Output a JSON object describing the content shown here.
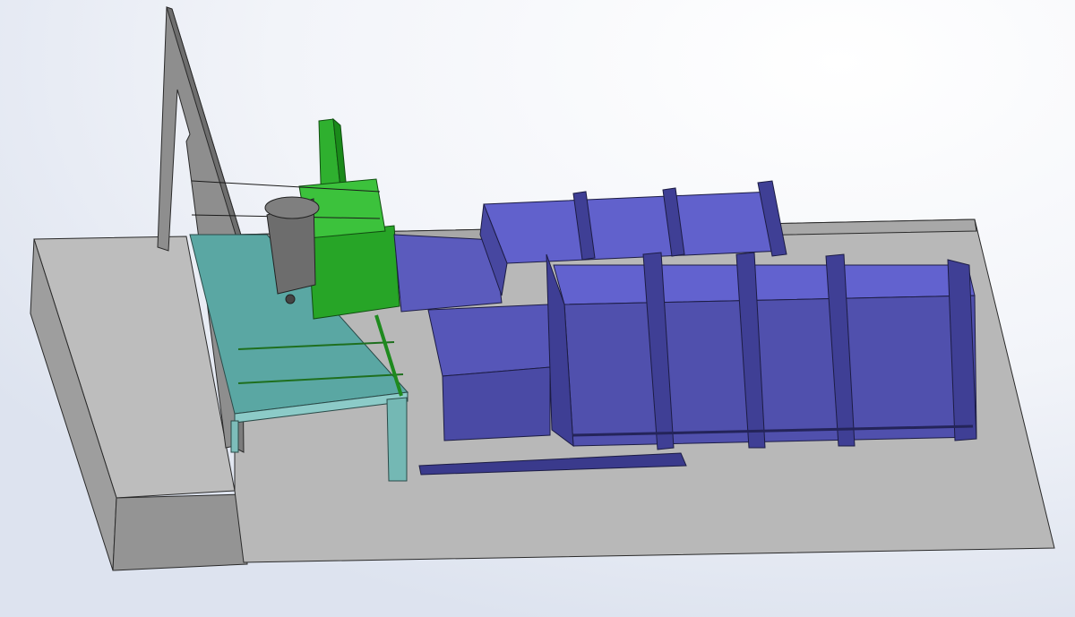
{
  "scene": {
    "colors": {
      "background_light": "#ffffff",
      "background_shade": "#dde3ef",
      "concrete_top": "#bdbdbd",
      "concrete_side": "#a2a2a2",
      "concrete_front": "#939393",
      "wall_face": "#8e8e8e",
      "wall_edge": "#6e6e6e",
      "platform_teal": "#56a3a0",
      "platform_teal_light": "#8ccbc8",
      "machine_green": "#27a527",
      "machine_green_dark": "#167d16",
      "bin_grey": "#6d6d6d",
      "container_top": "#5e5ec8",
      "container_side": "#4e4eaa",
      "container_dark": "#2f2f6e",
      "outline": "#222222"
    }
  }
}
